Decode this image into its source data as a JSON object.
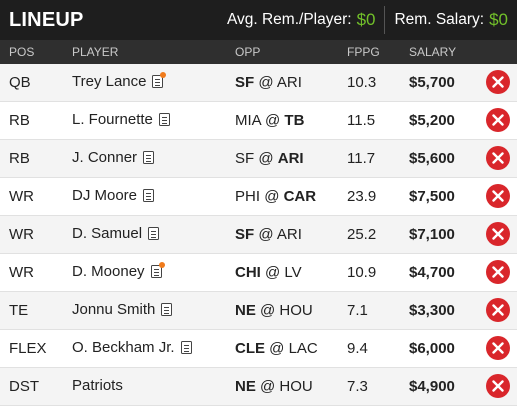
{
  "header": {
    "title": "LINEUP",
    "avg_label": "Avg. Rem./Player:",
    "avg_value": "$0",
    "rem_label": "Rem. Salary:",
    "rem_value": "$0"
  },
  "columns": {
    "pos": "POS",
    "player": "PLAYER",
    "opp": "OPP",
    "fppg": "FPPG",
    "salary": "SALARY"
  },
  "colors": {
    "accent_green": "#72c12a",
    "remove_red": "#d9262b",
    "news_alert": "#f07b1c"
  },
  "rows": [
    {
      "pos": "QB",
      "player": "Trey Lance",
      "news_alert": true,
      "away": "SF",
      "home": "ARI",
      "bold": "away",
      "fppg": "10.3",
      "salary": "$5,700"
    },
    {
      "pos": "RB",
      "player": "L. Fournette",
      "news_alert": false,
      "away": "MIA",
      "home": "TB",
      "bold": "home",
      "fppg": "11.5",
      "salary": "$5,200"
    },
    {
      "pos": "RB",
      "player": "J. Conner",
      "news_alert": false,
      "away": "SF",
      "home": "ARI",
      "bold": "home",
      "fppg": "11.7",
      "salary": "$5,600"
    },
    {
      "pos": "WR",
      "player": "DJ Moore",
      "news_alert": false,
      "away": "PHI",
      "home": "CAR",
      "bold": "home",
      "fppg": "23.9",
      "salary": "$7,500"
    },
    {
      "pos": "WR",
      "player": "D. Samuel",
      "news_alert": false,
      "away": "SF",
      "home": "ARI",
      "bold": "away",
      "fppg": "25.2",
      "salary": "$7,100"
    },
    {
      "pos": "WR",
      "player": "D. Mooney",
      "news_alert": true,
      "away": "CHI",
      "home": "LV",
      "bold": "away",
      "fppg": "10.9",
      "salary": "$4,700"
    },
    {
      "pos": "TE",
      "player": "Jonnu Smith",
      "news_alert": false,
      "away": "NE",
      "home": "HOU",
      "bold": "away",
      "fppg": "7.1",
      "salary": "$3,300"
    },
    {
      "pos": "FLEX",
      "player": "O. Beckham Jr.",
      "news_alert": false,
      "away": "CLE",
      "home": "LAC",
      "bold": "away",
      "fppg": "9.4",
      "salary": "$6,000"
    },
    {
      "pos": "DST",
      "player": "Patriots",
      "news_alert": false,
      "news_icon": false,
      "away": "NE",
      "home": "HOU",
      "bold": "away",
      "fppg": "7.3",
      "salary": "$4,900"
    }
  ]
}
